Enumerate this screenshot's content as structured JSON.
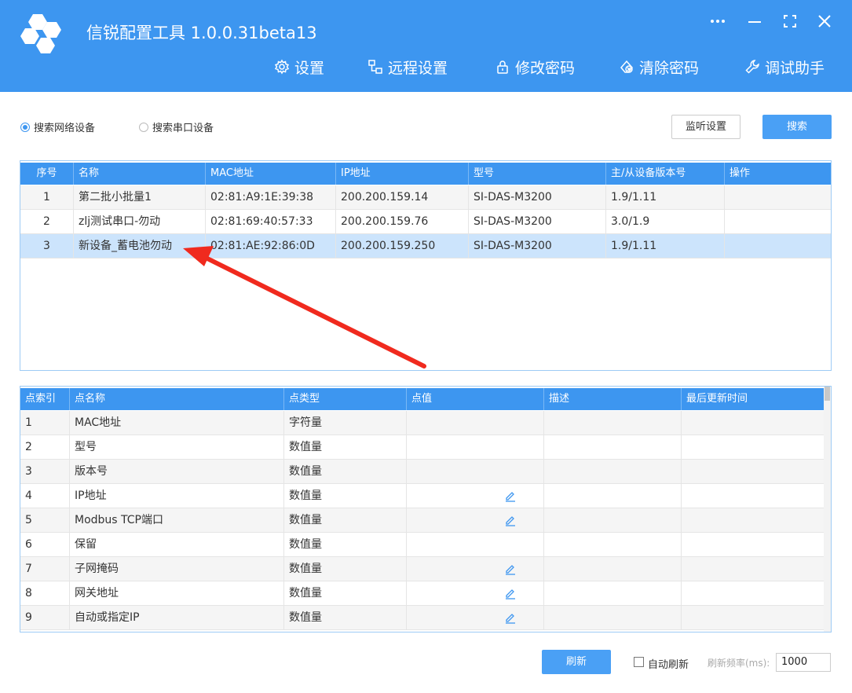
{
  "app": {
    "title": "信锐配置工具 1.0.0.31beta13",
    "window_controls": [
      "more-icon",
      "minimize-icon",
      "maximize-icon",
      "close-icon"
    ]
  },
  "menu": [
    {
      "label": "设置",
      "icon": "gear-icon"
    },
    {
      "label": "远程设置",
      "icon": "remote-icon"
    },
    {
      "label": "修改密码",
      "icon": "lock-icon"
    },
    {
      "label": "清除密码",
      "icon": "clear-password-icon"
    },
    {
      "label": "调试助手",
      "icon": "wrench-icon"
    }
  ],
  "search": {
    "network_label": "搜索网络设备",
    "serial_label": "搜索串口设备",
    "selected": "network",
    "listen_button": "监听设置",
    "search_button": "搜索"
  },
  "devices": {
    "headers": [
      "序号",
      "名称",
      "MAC地址",
      "IP地址",
      "型号",
      "主/从设备版本号",
      "操作"
    ],
    "rows": [
      {
        "no": "1",
        "name": "第二批小批量1",
        "mac": "02:81:A9:1E:39:38",
        "ip": "200.200.159.14",
        "model": "SI-DAS-M3200",
        "version": "1.9/1.11",
        "op": ""
      },
      {
        "no": "2",
        "name": "zlj测试串口-勿动",
        "mac": "02:81:69:40:57:33",
        "ip": "200.200.159.76",
        "model": "SI-DAS-M3200",
        "version": "3.0/1.9",
        "op": ""
      },
      {
        "no": "3",
        "name": "新设备_蓄电池勿动",
        "mac": "02:81:AE:92:86:0D",
        "ip": "200.200.159.250",
        "model": "SI-DAS-M3200",
        "version": "1.9/1.11",
        "op": ""
      }
    ],
    "selected_row": 2
  },
  "points": {
    "headers": [
      "点索引",
      "点名称",
      "点类型",
      "点值",
      "描述",
      "最后更新时间"
    ],
    "rows": [
      {
        "idx": "1",
        "name": "MAC地址",
        "type": "字符量",
        "value": "",
        "editable": false,
        "desc": "",
        "time": ""
      },
      {
        "idx": "2",
        "name": "型号",
        "type": "数值量",
        "value": "",
        "editable": false,
        "desc": "",
        "time": ""
      },
      {
        "idx": "3",
        "name": "版本号",
        "type": "数值量",
        "value": "",
        "editable": false,
        "desc": "",
        "time": ""
      },
      {
        "idx": "4",
        "name": "IP地址",
        "type": "数值量",
        "value": "",
        "editable": true,
        "desc": "",
        "time": ""
      },
      {
        "idx": "5",
        "name": "Modbus TCP端口",
        "type": "数值量",
        "value": "",
        "editable": true,
        "desc": "",
        "time": ""
      },
      {
        "idx": "6",
        "name": "保留",
        "type": "数值量",
        "value": "",
        "editable": false,
        "desc": "",
        "time": ""
      },
      {
        "idx": "7",
        "name": "子网掩码",
        "type": "数值量",
        "value": "",
        "editable": true,
        "desc": "",
        "time": ""
      },
      {
        "idx": "8",
        "name": "网关地址",
        "type": "数值量",
        "value": "",
        "editable": true,
        "desc": "",
        "time": ""
      },
      {
        "idx": "9",
        "name": "自动或指定IP",
        "type": "数值量",
        "value": "",
        "editable": true,
        "desc": "",
        "time": ""
      }
    ]
  },
  "footer": {
    "refresh_button": "刷新",
    "auto_refresh_label": "自动刷新",
    "auto_refresh_checked": false,
    "frequency_label": "刷新频率(ms):",
    "frequency_value": "1000"
  },
  "colors": {
    "brand": "#3d96f0",
    "selected_row": "#cce4fc",
    "annotation_arrow": "#f02a1e"
  }
}
